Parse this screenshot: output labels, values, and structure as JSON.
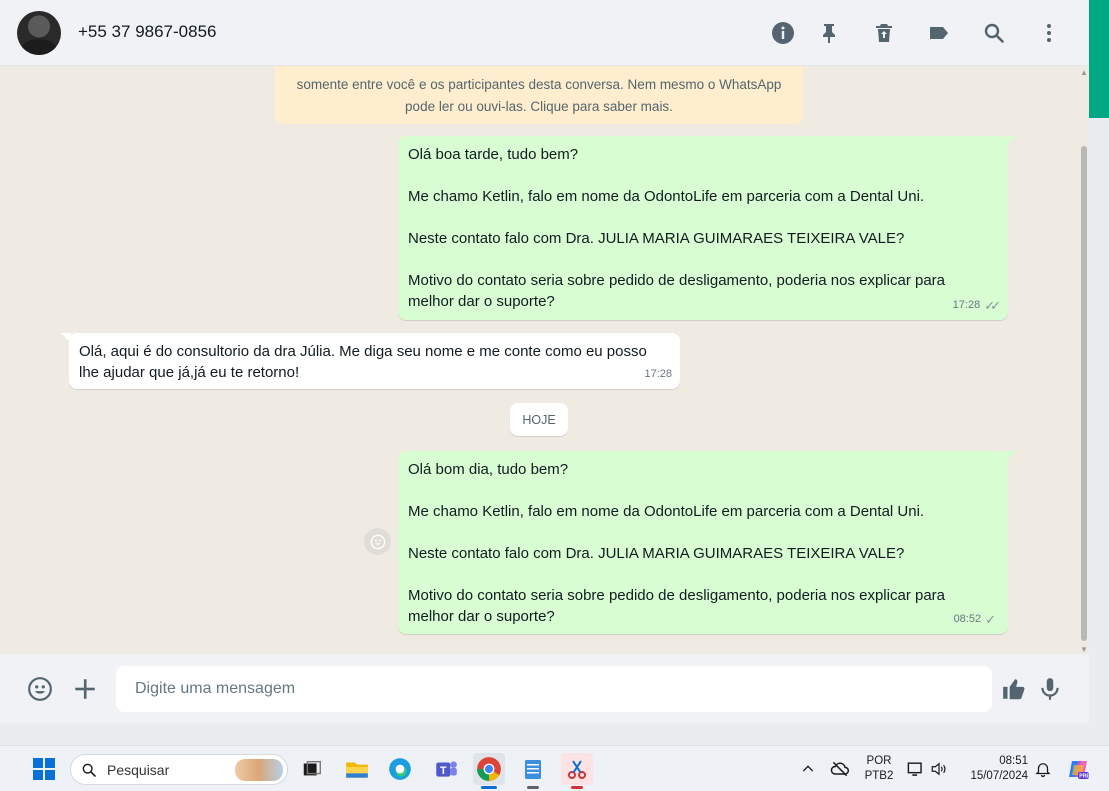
{
  "header": {
    "contact_name": "+55 37 9867-0856",
    "icons": [
      "info-icon",
      "pin-icon",
      "delete-icon",
      "label-icon",
      "search-icon",
      "menu-icon"
    ]
  },
  "encryption_notice": {
    "line2": "somente entre você e os participantes desta conversa. Nem mesmo o WhatsApp",
    "line3": "pode ler ou ouvi-las. Clique para saber mais."
  },
  "messages": [
    {
      "direction": "out",
      "text": "Olá boa tarde, tudo bem?\n\nMe chamo Ketlin, falo em nome da OdontoLife em parceria com a Dental Uni.\n\nNeste contato falo com Dra. JULIA MARIA GUIMARAES TEIXEIRA VALE?\n\nMotivo do contato seria sobre pedido de desligamento, poderia nos explicar para\nmelhor dar o suporte?",
      "time": "17:28",
      "status": "read"
    },
    {
      "direction": "in",
      "text": "Olá, aqui é do consultorio da dra Júlia. Me diga seu nome e me conte como eu posso\nlhe ajudar que já,já eu te retorno!",
      "time": "17:28"
    },
    {
      "direction": "out",
      "text": "Olá bom dia, tudo bem?\n\nMe chamo Ketlin, falo em nome da OdontoLife em parceria com a Dental Uni.\n\nNeste contato falo com Dra. JULIA MARIA GUIMARAES TEIXEIRA VALE?\n\nMotivo do contato seria sobre pedido de desligamento, poderia nos explicar para\nmelhor dar o suporte?",
      "time": "08:52",
      "status": "sent"
    }
  ],
  "date_divider": "HOJE",
  "composer": {
    "placeholder": "Digite uma mensagem"
  },
  "taskbar": {
    "search_label": "Pesquisar",
    "language_line1": "POR",
    "language_line2": "PTB2",
    "time": "08:51",
    "date": "15/07/2024"
  },
  "colors": {
    "outgoing_bubble": "#d9fdd3",
    "incoming_bubble": "#ffffff",
    "chat_background": "#efeae2",
    "brand_green": "#00a884"
  }
}
